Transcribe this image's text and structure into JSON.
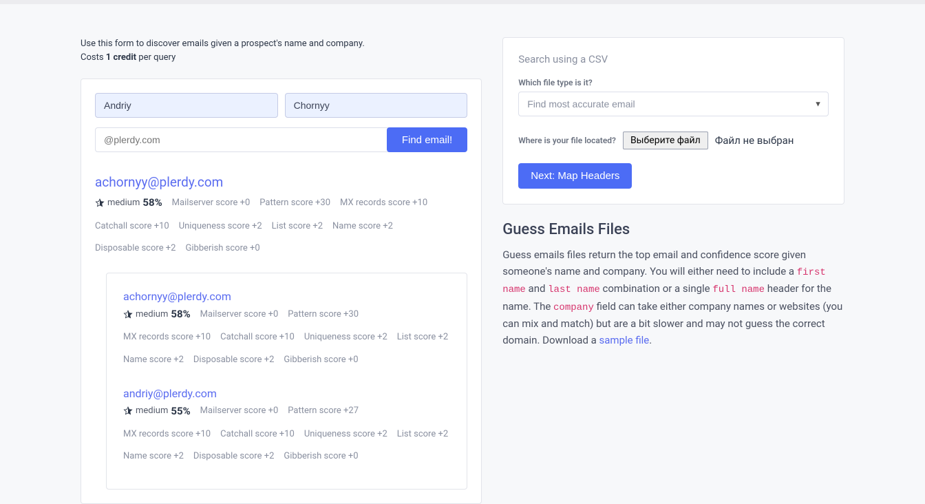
{
  "intro": {
    "line1": "Use this form to discover emails given a prospect's name and company.",
    "costs_prefix": "Costs ",
    "costs_bold": "1 credit",
    "costs_suffix": " per query"
  },
  "form": {
    "first_name": "Andriy",
    "last_name": "Chornyy",
    "domain_placeholder": "@plerdy.com",
    "find_button": "Find email!"
  },
  "top_result": {
    "email": "achornyy@plerdy.com",
    "confidence_label": "medium",
    "percent": "58%",
    "scores": [
      "Mailserver score +0",
      "Pattern score +30",
      "MX records score +10",
      "Catchall score +10",
      "Uniqueness score +2",
      "List score +2",
      "Name score +2",
      "Disposable score +2",
      "Gibberish score +0"
    ]
  },
  "candidates": [
    {
      "email": "achornyy@plerdy.com",
      "confidence_label": "medium",
      "percent": "58%",
      "scores": [
        "Mailserver score +0",
        "Pattern score +30",
        "MX records score +10",
        "Catchall score +10",
        "Uniqueness score +2",
        "List score +2",
        "Name score +2",
        "Disposable score +2",
        "Gibberish score +0"
      ]
    },
    {
      "email": "andriy@plerdy.com",
      "confidence_label": "medium",
      "percent": "55%",
      "scores": [
        "Mailserver score +0",
        "Pattern score +27",
        "MX records score +10",
        "Catchall score +10",
        "Uniqueness score +2",
        "List score +2",
        "Name score +2",
        "Disposable score +2",
        "Gibberish score +0"
      ]
    }
  ],
  "csv": {
    "title": "Search using a CSV",
    "which_file": "Which file type is it?",
    "select_value": "Find most accurate email",
    "where_file": "Where is your file located?",
    "pick_button": "Выберите файл",
    "no_file": "Файл не выбран",
    "next_button": "Next: Map Headers"
  },
  "guess": {
    "heading": "Guess Emails Files",
    "body_a": "Guess emails files return the top email and confidence score given someone's name and company. You will either need to include a ",
    "code_first": "first name",
    "body_b": " and ",
    "code_last": "last name",
    "body_c": " combination or a single ",
    "code_full": "full name",
    "body_d": " header for the name. The ",
    "code_company": "company",
    "body_e": " field can take either company names or websites (you can mix and match) but are a bit slower and may not guess the correct domain. Download a ",
    "sample_link": "sample file",
    "body_f": "."
  }
}
